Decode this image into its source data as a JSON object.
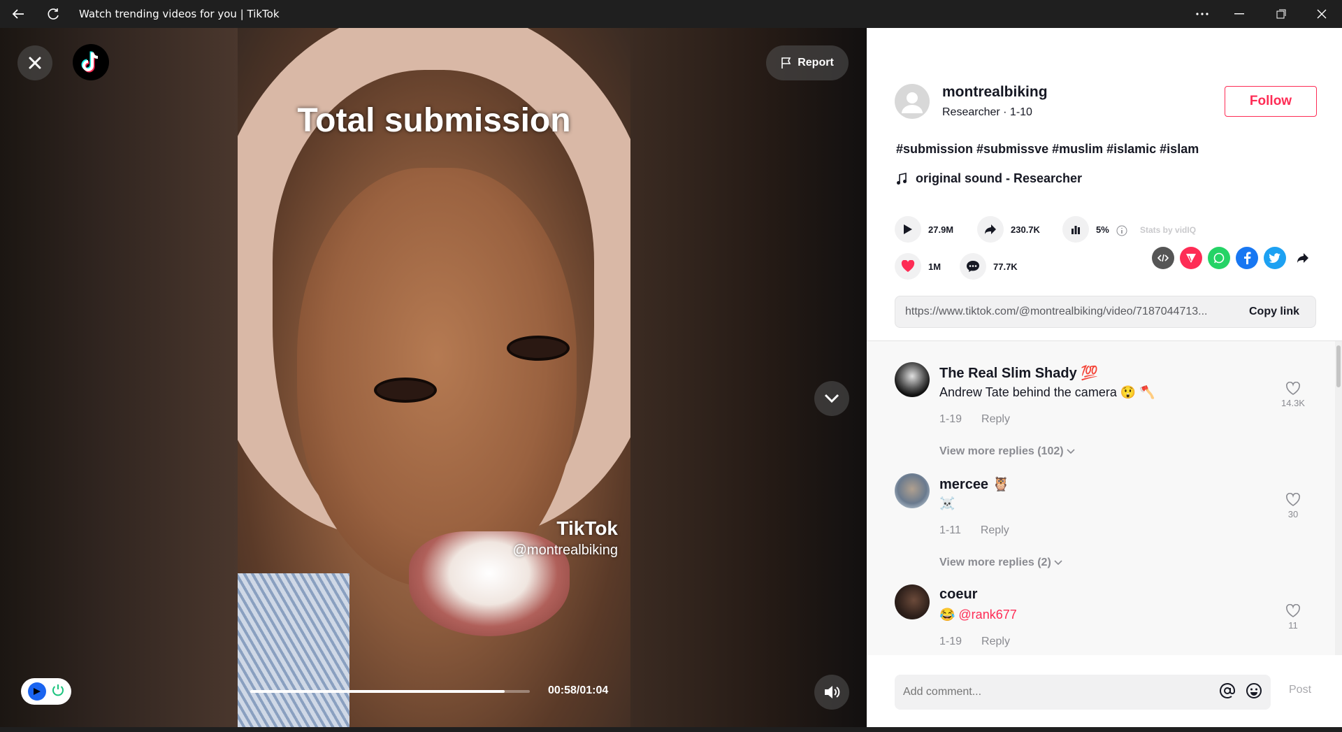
{
  "window": {
    "title": "Watch trending videos for you | TikTok",
    "back_icon": "back-arrow-icon",
    "refresh_icon": "refresh-icon"
  },
  "player": {
    "overlay_text": "Total submission",
    "watermark_logo": "TikTok",
    "watermark_user": "@montrealbiking",
    "timecode": "00:58/01:04",
    "progress": 0.91,
    "report_label": "Report"
  },
  "author": {
    "name": "montrealbiking",
    "subtitle": "Researcher · 1-10",
    "follow_label": "Follow"
  },
  "caption": "#submission #submissve #muslim #islamic #islam",
  "sound": "original sound - Researcher",
  "stats": {
    "plays": "27.9M",
    "shares": "230.7K",
    "engagement": "5%",
    "vidiq_label": "Stats by vidIQ",
    "likes": "1M",
    "comments": "77.7K"
  },
  "link": {
    "url": "https://www.tiktok.com/@montrealbiking/video/7187044713...",
    "copy_label": "Copy link"
  },
  "comments": [
    {
      "name": "The Real Slim Shady 💯",
      "text": "Andrew Tate behind the camera 😲 🪓",
      "date": "1-19",
      "reply": "Reply",
      "likes": "14.3K",
      "replies": "View more replies (102)"
    },
    {
      "name": "mercee 🦉",
      "text": "☠️",
      "date": "1-11",
      "reply": "Reply",
      "likes": "30",
      "replies": "View more replies (2)"
    },
    {
      "name": "coeur",
      "text": "😂 @rank677",
      "date": "1-19",
      "reply": "Reply",
      "likes": "11"
    }
  ],
  "composer": {
    "placeholder": "Add comment...",
    "post_label": "Post"
  },
  "colors": {
    "accent": "#fe2c55",
    "text": "#161823",
    "muted": "#8a8b91"
  }
}
